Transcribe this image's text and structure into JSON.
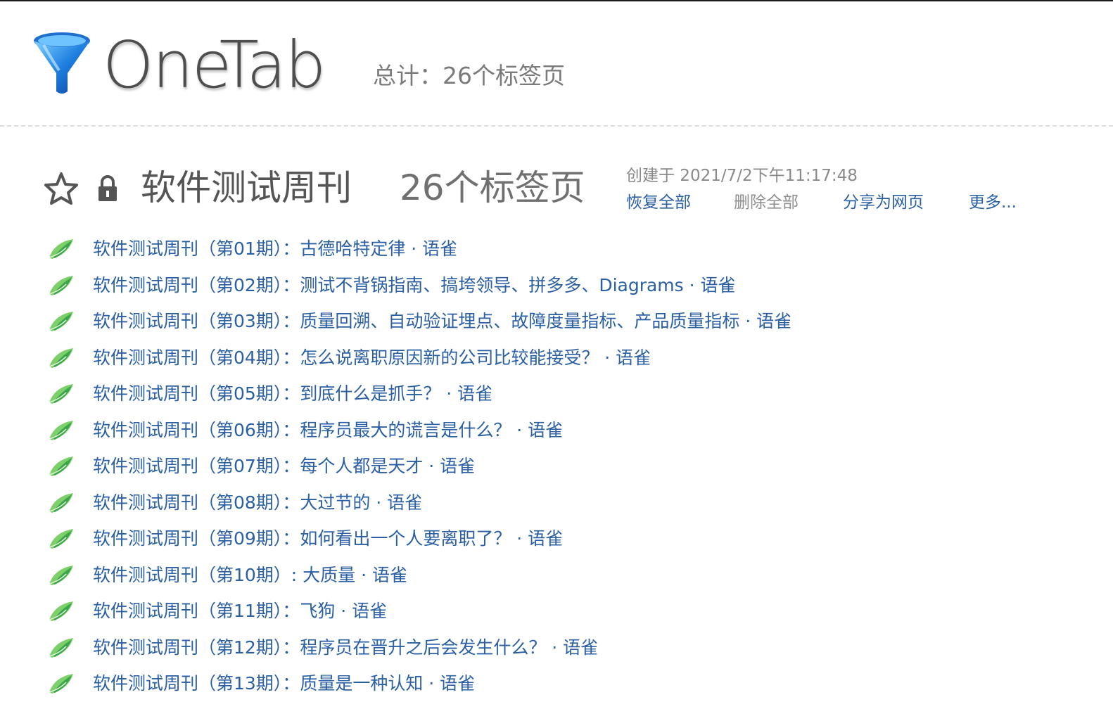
{
  "app": {
    "name": "OneTab"
  },
  "header": {
    "total": "总计：26个标签页"
  },
  "group": {
    "title": "软件测试周刊",
    "count": "26个标签页",
    "created": "创建于 2021/7/2下午11:17:48",
    "actions": {
      "restore_all": "恢复全部",
      "delete_all": "删除全部",
      "share_as_webpage": "分享为网页",
      "more": "更多..."
    }
  },
  "colors": {
    "link": "#2a5fa3",
    "muted": "#8f8f8f",
    "favicon_green": "#4caf50"
  },
  "tabs": [
    {
      "title": "软件测试周刊（第01期）：古德哈特定律 · 语雀"
    },
    {
      "title": "软件测试周刊（第02期）：测试不背锅指南、搞垮领导、拼多多、Diagrams · 语雀"
    },
    {
      "title": "软件测试周刊（第03期）：质量回溯、自动验证埋点、故障度量指标、产品质量指标 · 语雀"
    },
    {
      "title": "软件测试周刊（第04期）：怎么说离职原因新的公司比较能接受？ · 语雀"
    },
    {
      "title": "软件测试周刊（第05期）：到底什么是抓手？ · 语雀"
    },
    {
      "title": "软件测试周刊（第06期）：程序员最大的谎言是什么？ · 语雀"
    },
    {
      "title": "软件测试周刊（第07期）：每个人都是天才 · 语雀"
    },
    {
      "title": "软件测试周刊（第08期）：大过节的 · 语雀"
    },
    {
      "title": "软件测试周刊（第09期）：如何看出一个人要离职了？ · 语雀"
    },
    {
      "title": "软件测试周刊（第10期）: 大质量 · 语雀"
    },
    {
      "title": "软件测试周刊（第11期）：飞狗 · 语雀"
    },
    {
      "title": "软件测试周刊（第12期）：程序员在晋升之后会发生什么？ · 语雀"
    },
    {
      "title": "软件测试周刊（第13期）：质量是一种认知 · 语雀"
    }
  ]
}
